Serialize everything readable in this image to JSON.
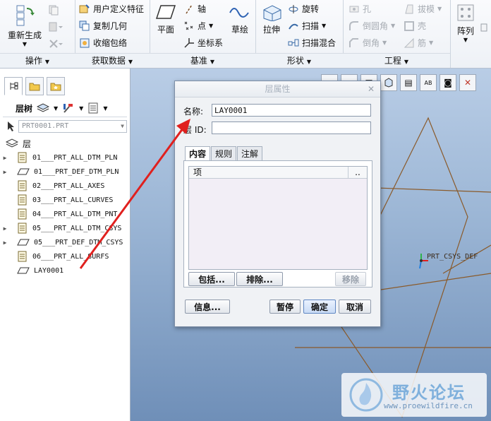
{
  "ribbon": {
    "regenerate_label": "重新生成",
    "groups": [
      "操作",
      "获取数据",
      "基准",
      "形状",
      "工程"
    ],
    "get_data": {
      "udf_label": "用户定义特征",
      "copy_geom_label": "复制几何",
      "shrinkwrap_label": "收缩包络"
    },
    "datum": {
      "plane_label": "平面",
      "axis_label": "轴",
      "point_label": "点",
      "csys_label": "坐标系",
      "sketch_label": "草绘"
    },
    "shapes": {
      "extrude_label": "拉伸",
      "revolve_label": "旋转",
      "sweep_label": "扫描",
      "blend_label": "扫描混合"
    },
    "engineering": {
      "hole_label": "孔",
      "round_label": "倒圆角",
      "chamfer_label": "倒角",
      "draft_label": "拔模",
      "shell_label": "壳",
      "rib_label": "筋"
    },
    "pattern_label": "阵列"
  },
  "panel": {
    "tree_label": "层树",
    "model_name": "PRT0001.PRT",
    "root_label": "层",
    "layers": [
      {
        "name": "01___PRT_ALL_DTM_PLN",
        "expandable": true,
        "icon": "layer-list-icon"
      },
      {
        "name": "01___PRT_DEF_DTM_PLN",
        "expandable": true,
        "icon": "layer-plane-icon"
      },
      {
        "name": "02___PRT_ALL_AXES",
        "expandable": false,
        "icon": "layer-list-icon"
      },
      {
        "name": "03___PRT_ALL_CURVES",
        "expandable": false,
        "icon": "layer-list-icon"
      },
      {
        "name": "04___PRT_ALL_DTM_PNT",
        "expandable": false,
        "icon": "layer-list-icon"
      },
      {
        "name": "05___PRT_ALL_DTM_CSYS",
        "expandable": true,
        "icon": "layer-list-icon"
      },
      {
        "name": "05___PRT_DEF_DTM_CSYS",
        "expandable": true,
        "icon": "layer-plane-icon"
      },
      {
        "name": "06___PRT_ALL_SURFS",
        "expandable": false,
        "icon": "layer-list-icon"
      },
      {
        "name": "LAY0001",
        "expandable": false,
        "icon": "layer-plane-icon"
      }
    ]
  },
  "viewport": {
    "csys_label": "PRT_CSYS_DEF"
  },
  "dialog": {
    "title": "层属性",
    "name_label": "名称:",
    "name_value": "LAY0001",
    "id_label": "层 ID:",
    "id_value": "",
    "tabs": [
      "内容",
      "规则",
      "注解"
    ],
    "list_header_item": "项",
    "list_header_status": "..",
    "include_label": "包括...",
    "exclude_label": "排除...",
    "remove_label": "移除",
    "info_label": "信息...",
    "pause_label": "暂停",
    "ok_label": "确定",
    "cancel_label": "取消"
  },
  "watermark": {
    "title": "野火论坛",
    "url": "www.proewildfire.cn"
  },
  "colors": {
    "viewport_top": "#b9cde6",
    "viewport_bottom": "#6f8fb8",
    "wire": "#8a5a2a",
    "arrow": "#e0201e"
  }
}
